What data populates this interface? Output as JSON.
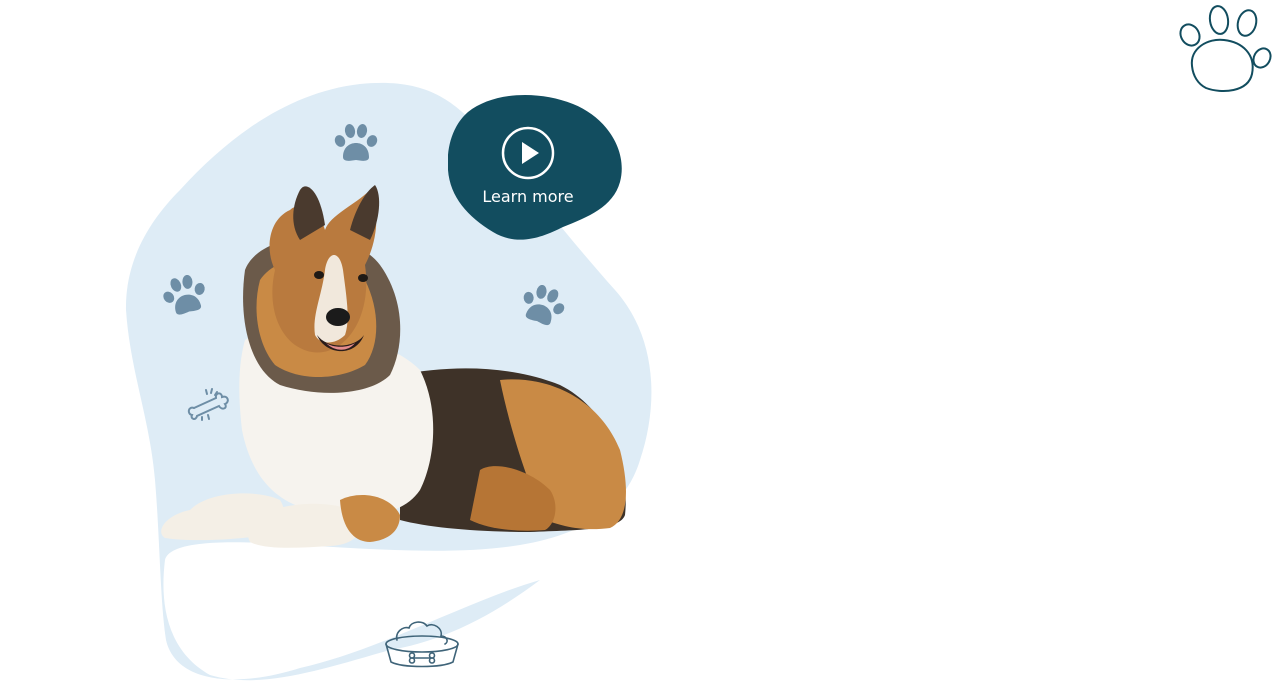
{
  "colors": {
    "blob": "#deecf6",
    "teal": "#124d5f",
    "paw_blue": "#6e8ea6",
    "outline": "#3f6479"
  },
  "hero": {
    "learn_more_label": "Learn more",
    "play_icon": "play-icon",
    "image": "dog-photo"
  }
}
